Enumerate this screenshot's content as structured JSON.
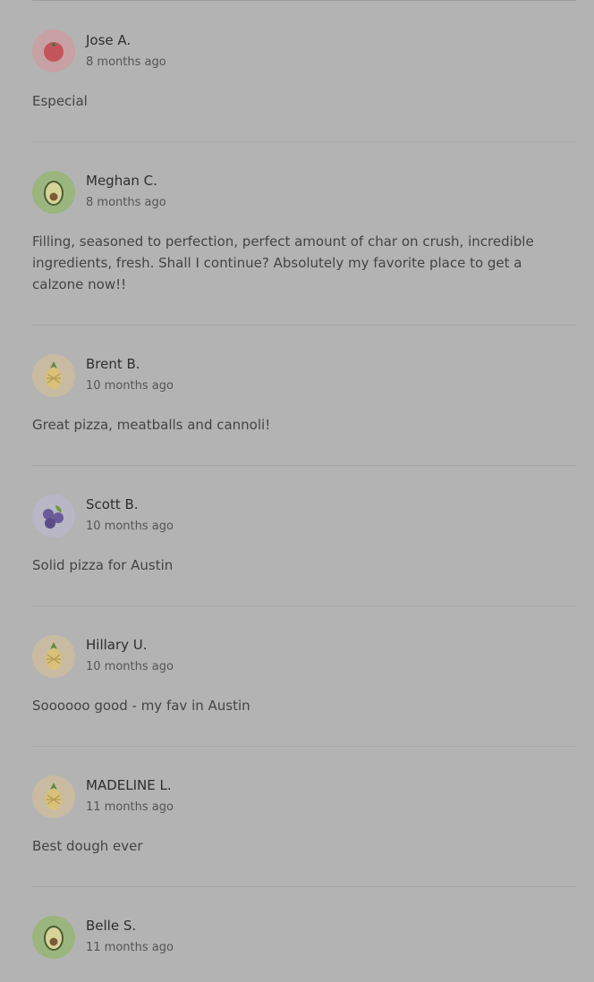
{
  "reviews": [
    {
      "name": "Jose A.",
      "time": "8 months ago",
      "text": "Especial",
      "avatar": "tomato-icon"
    },
    {
      "name": "Meghan C.",
      "time": "8 months ago",
      "text": "Filling, seasoned to perfection, perfect amount of char on crush, incredible ingredients, fresh. Shall I continue? Absolutely my favorite place to get a calzone now!!",
      "avatar": "avocado-icon"
    },
    {
      "name": "Brent B.",
      "time": "10 months ago",
      "text": "Great pizza, meatballs and cannoli!",
      "avatar": "pineapple-icon"
    },
    {
      "name": "Scott B.",
      "time": "10 months ago",
      "text": "Solid pizza for Austin",
      "avatar": "blueberry-icon"
    },
    {
      "name": "Hillary U.",
      "time": "10 months ago",
      "text": "Soooooo good - my fav in Austin",
      "avatar": "pineapple-icon"
    },
    {
      "name": "MADELINE L.",
      "time": "11 months ago",
      "text": "Best dough ever",
      "avatar": "pineapple-icon"
    },
    {
      "name": "Belle S.",
      "time": "11 months ago",
      "text": "",
      "avatar": "avocado-icon"
    }
  ],
  "colors": {
    "overlay_bg": "#b3b3b3",
    "tomato": "#c4555b",
    "avocado": "#9bb57e",
    "pineapple": "#d9c17a",
    "blueberry": "#6a5a9a"
  }
}
